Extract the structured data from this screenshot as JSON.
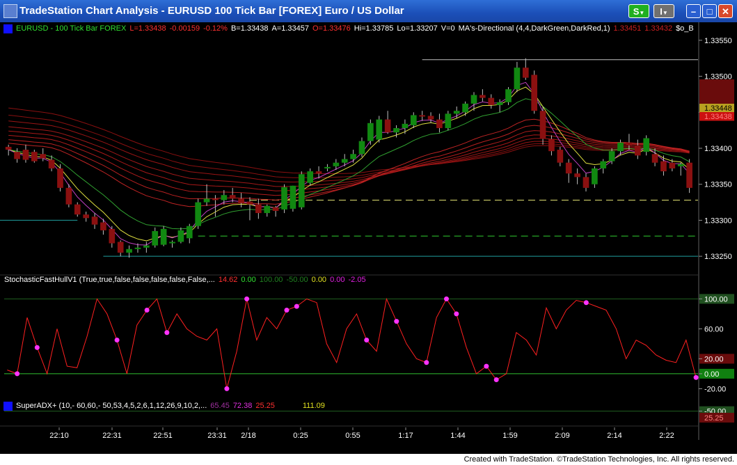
{
  "window": {
    "title": "TradeStation Chart Analysis - EURUSD 100 Tick Bar [FOREX] Euro / US Dollar",
    "s_button": "S",
    "i_button": "I",
    "minimize_glyph": "–",
    "maximize_glyph": "□",
    "close_glyph": "✕"
  },
  "colors": {
    "background": "#000000",
    "up_candle": "#118811",
    "down_candle": "#8b1010",
    "stoch_line": "#ff2020",
    "marker": "#ff33ff",
    "title_bar": "#1b4fb8"
  },
  "price_legend": {
    "symbol": "EURUSD - 100 Tick Bar  FOREX",
    "last": "L=1.33438",
    "change": "-0.00159",
    "pct": "-0.12%",
    "bid": "B=1.33438",
    "ask": "A=1.33457",
    "open": "O=1.33476",
    "high": "Hi=1.33785",
    "low": "Lo=1.33207",
    "volume": "V=0",
    "study": "MA's-Directional (4,4,DarkGreen,DarkRed,1)",
    "v1": "1.33451",
    "v2": "1.33432",
    "extra": "$o_B"
  },
  "stoch_legend": {
    "name": "StochasticFastHullV1 (True,true,false,false,false,false,False,...",
    "v1": "14.62",
    "v2": "0.00",
    "v3": "100.00",
    "v4": "-50.00",
    "v5": "0.00",
    "v6": "0.00",
    "v7": "-2.05"
  },
  "adx_legend": {
    "name": "SuperADX+ (10,- 60,60,- 50,53,4,5,2,6,1,12,26,9,10,2,...",
    "v1": "65.45",
    "v2": "72.38",
    "v3": "25.25",
    "v4": "111.09"
  },
  "price_axis": [
    "1.33550",
    "1.33500",
    "1.33450",
    "1.33400",
    "1.33350",
    "1.33300",
    "1.33250"
  ],
  "price_tags": [
    {
      "label": "1.33448",
      "color": "#b8a020",
      "text_color": "#000000"
    },
    {
      "label": "1.33438",
      "color": "#cc1010",
      "text_color": "#ff8080"
    }
  ],
  "stoch_axis": [
    "100.00",
    "60.00",
    "20.00",
    "0.00",
    "-20.00",
    "-50.00"
  ],
  "adx_axis": [
    "25.25"
  ],
  "time_axis": [
    "22:10",
    "22:31",
    "22:51",
    "23:31",
    "2/18",
    "0:25",
    "0:55",
    "1:17",
    "1:44",
    "1:59",
    "2:09",
    "2:14",
    "2:22"
  ],
  "candles": [
    {
      "o": 1.33402,
      "h": 1.33405,
      "l": 1.3339,
      "c": 1.33398
    },
    {
      "o": 1.33395,
      "h": 1.334,
      "l": 1.3338,
      "c": 1.33385
    },
    {
      "o": 1.33398,
      "h": 1.33405,
      "l": 1.3338,
      "c": 1.33384
    },
    {
      "o": 1.33395,
      "h": 1.33398,
      "l": 1.3338,
      "c": 1.33382
    },
    {
      "o": 1.33392,
      "h": 1.334,
      "l": 1.33382,
      "c": 1.33386
    },
    {
      "o": 1.33384,
      "h": 1.3339,
      "l": 1.33368,
      "c": 1.33372
    },
    {
      "o": 1.33372,
      "h": 1.33378,
      "l": 1.3334,
      "c": 1.33345
    },
    {
      "o": 1.33345,
      "h": 1.3335,
      "l": 1.33318,
      "c": 1.33322
    },
    {
      "o": 1.33322,
      "h": 1.33325,
      "l": 1.33305,
      "c": 1.33308
    },
    {
      "o": 1.33308,
      "h": 1.33312,
      "l": 1.33298,
      "c": 1.33303
    },
    {
      "o": 1.33305,
      "h": 1.3331,
      "l": 1.33288,
      "c": 1.33294
    },
    {
      "o": 1.33297,
      "h": 1.33302,
      "l": 1.3328,
      "c": 1.33286
    },
    {
      "o": 1.33288,
      "h": 1.33292,
      "l": 1.33262,
      "c": 1.33268
    },
    {
      "o": 1.3327,
      "h": 1.33272,
      "l": 1.3325,
      "c": 1.33255
    },
    {
      "o": 1.33255,
      "h": 1.33265,
      "l": 1.33248,
      "c": 1.3326
    },
    {
      "o": 1.3326,
      "h": 1.33268,
      "l": 1.33255,
      "c": 1.33262
    },
    {
      "o": 1.33262,
      "h": 1.3327,
      "l": 1.33255,
      "c": 1.33265
    },
    {
      "o": 1.33265,
      "h": 1.3329,
      "l": 1.33262,
      "c": 1.33285
    },
    {
      "o": 1.33266,
      "h": 1.33292,
      "l": 1.33264,
      "c": 1.33288
    },
    {
      "o": 1.33268,
      "h": 1.33272,
      "l": 1.33262,
      "c": 1.3327
    },
    {
      "o": 1.3327,
      "h": 1.3329,
      "l": 1.33268,
      "c": 1.33286
    },
    {
      "o": 1.33275,
      "h": 1.33295,
      "l": 1.33268,
      "c": 1.33292
    },
    {
      "o": 1.33292,
      "h": 1.3333,
      "l": 1.33288,
      "c": 1.33325
    },
    {
      "o": 1.33325,
      "h": 1.3335,
      "l": 1.3332,
      "c": 1.3333
    },
    {
      "o": 1.3333,
      "h": 1.33335,
      "l": 1.33305,
      "c": 1.33328
    },
    {
      "o": 1.33328,
      "h": 1.33342,
      "l": 1.33322,
      "c": 1.33335
    },
    {
      "o": 1.33335,
      "h": 1.33345,
      "l": 1.33325,
      "c": 1.3333
    },
    {
      "o": 1.3333,
      "h": 1.33338,
      "l": 1.33318,
      "c": 1.33324
    },
    {
      "o": 1.33326,
      "h": 1.33332,
      "l": 1.333,
      "c": 1.33322
    },
    {
      "o": 1.33322,
      "h": 1.3333,
      "l": 1.33302,
      "c": 1.3331
    },
    {
      "o": 1.3331,
      "h": 1.33322,
      "l": 1.33305,
      "c": 1.3332
    },
    {
      "o": 1.33318,
      "h": 1.3332,
      "l": 1.33305,
      "c": 1.33313
    },
    {
      "o": 1.33315,
      "h": 1.3335,
      "l": 1.3331,
      "c": 1.33346
    },
    {
      "o": 1.33316,
      "h": 1.33348,
      "l": 1.33312,
      "c": 1.33348
    },
    {
      "o": 1.33318,
      "h": 1.33368,
      "l": 1.33315,
      "c": 1.33364
    },
    {
      "o": 1.33352,
      "h": 1.33372,
      "l": 1.33348,
      "c": 1.33368
    },
    {
      "o": 1.33368,
      "h": 1.33375,
      "l": 1.33358,
      "c": 1.33365
    },
    {
      "o": 1.33372,
      "h": 1.33378,
      "l": 1.33368,
      "c": 1.33374
    },
    {
      "o": 1.33375,
      "h": 1.33385,
      "l": 1.3337,
      "c": 1.3338
    },
    {
      "o": 1.3338,
      "h": 1.33392,
      "l": 1.33375,
      "c": 1.33385
    },
    {
      "o": 1.33385,
      "h": 1.33398,
      "l": 1.3338,
      "c": 1.33392
    },
    {
      "o": 1.33392,
      "h": 1.33415,
      "l": 1.33388,
      "c": 1.3341
    },
    {
      "o": 1.3341,
      "h": 1.3344,
      "l": 1.33405,
      "c": 1.33435
    },
    {
      "o": 1.33412,
      "h": 1.33445,
      "l": 1.33408,
      "c": 1.3344
    },
    {
      "o": 1.3344,
      "h": 1.33452,
      "l": 1.3342,
      "c": 1.33422
    },
    {
      "o": 1.33422,
      "h": 1.33432,
      "l": 1.33415,
      "c": 1.33428
    },
    {
      "o": 1.33428,
      "h": 1.3344,
      "l": 1.3342,
      "c": 1.33434
    },
    {
      "o": 1.33432,
      "h": 1.3345,
      "l": 1.33428,
      "c": 1.33446
    },
    {
      "o": 1.33446,
      "h": 1.33452,
      "l": 1.33438,
      "c": 1.33444
    },
    {
      "o": 1.33445,
      "h": 1.3345,
      "l": 1.33435,
      "c": 1.3344
    },
    {
      "o": 1.3344,
      "h": 1.33448,
      "l": 1.33422,
      "c": 1.33428
    },
    {
      "o": 1.33428,
      "h": 1.33452,
      "l": 1.33425,
      "c": 1.33448
    },
    {
      "o": 1.33448,
      "h": 1.33458,
      "l": 1.33442,
      "c": 1.33452
    },
    {
      "o": 1.3345,
      "h": 1.33465,
      "l": 1.33445,
      "c": 1.33462
    },
    {
      "o": 1.33462,
      "h": 1.33478,
      "l": 1.33452,
      "c": 1.33474
    },
    {
      "o": 1.33474,
      "h": 1.33482,
      "l": 1.33465,
      "c": 1.3347
    },
    {
      "o": 1.3347,
      "h": 1.33475,
      "l": 1.33455,
      "c": 1.3346
    },
    {
      "o": 1.3346,
      "h": 1.33468,
      "l": 1.3345,
      "c": 1.33464
    },
    {
      "o": 1.33464,
      "h": 1.33485,
      "l": 1.3346,
      "c": 1.33482
    },
    {
      "o": 1.33482,
      "h": 1.3352,
      "l": 1.33478,
      "c": 1.33512
    },
    {
      "o": 1.33512,
      "h": 1.33525,
      "l": 1.33495,
      "c": 1.33498
    },
    {
      "o": 1.33502,
      "h": 1.33508,
      "l": 1.33448,
      "c": 1.33452
    },
    {
      "o": 1.33452,
      "h": 1.33458,
      "l": 1.33405,
      "c": 1.33413
    },
    {
      "o": 1.33413,
      "h": 1.33418,
      "l": 1.3339,
      "c": 1.33396
    },
    {
      "o": 1.33398,
      "h": 1.33402,
      "l": 1.33375,
      "c": 1.3338
    },
    {
      "o": 1.3338,
      "h": 1.33385,
      "l": 1.33352,
      "c": 1.33365
    },
    {
      "o": 1.33365,
      "h": 1.33372,
      "l": 1.3335,
      "c": 1.3336
    },
    {
      "o": 1.3336,
      "h": 1.33365,
      "l": 1.3334,
      "c": 1.33345
    },
    {
      "o": 1.3335,
      "h": 1.33375,
      "l": 1.33345,
      "c": 1.33372
    },
    {
      "o": 1.33372,
      "h": 1.33385,
      "l": 1.33365,
      "c": 1.33382
    },
    {
      "o": 1.33382,
      "h": 1.334,
      "l": 1.33378,
      "c": 1.33396
    },
    {
      "o": 1.33396,
      "h": 1.33412,
      "l": 1.3339,
      "c": 1.33408
    },
    {
      "o": 1.33408,
      "h": 1.3342,
      "l": 1.33398,
      "c": 1.33404
    },
    {
      "o": 1.33404,
      "h": 1.33412,
      "l": 1.33385,
      "c": 1.3339
    },
    {
      "o": 1.33395,
      "h": 1.33418,
      "l": 1.3339,
      "c": 1.33414
    },
    {
      "o": 1.33392,
      "h": 1.334,
      "l": 1.33375,
      "c": 1.3338
    },
    {
      "o": 1.33382,
      "h": 1.3339,
      "l": 1.33362,
      "c": 1.33368
    },
    {
      "o": 1.3338,
      "h": 1.33385,
      "l": 1.33368,
      "c": 1.33372
    },
    {
      "o": 1.33375,
      "h": 1.3338,
      "l": 1.33362,
      "c": 1.33378
    },
    {
      "o": 1.3338,
      "h": 1.33385,
      "l": 1.33338,
      "c": 1.33345
    }
  ],
  "stoch_values": [
    5,
    0,
    75,
    35,
    0,
    60,
    10,
    8,
    50,
    100,
    80,
    45,
    0,
    65,
    85,
    100,
    55,
    80,
    60,
    50,
    45,
    60,
    -20,
    30,
    100,
    45,
    75,
    60,
    85,
    90,
    100,
    95,
    40,
    15,
    60,
    80,
    45,
    30,
    100,
    70,
    40,
    20,
    15,
    75,
    100,
    80,
    35,
    0,
    10,
    -8,
    0,
    55,
    45,
    25,
    88,
    60,
    85,
    98,
    95,
    90,
    85,
    60,
    20,
    45,
    38,
    25,
    18,
    15,
    45,
    -5
  ],
  "stoch_markers": [
    1,
    3,
    11,
    14,
    16,
    22,
    24,
    28,
    29,
    36,
    39,
    42,
    44,
    45,
    48,
    49,
    58,
    69
  ],
  "horizontal_levels": [
    {
      "price": 1.333,
      "style": "solid",
      "color": "#20a0a0"
    },
    {
      "price": 1.3325,
      "style": "solid",
      "color": "#20a0a0"
    },
    {
      "price": 1.33328,
      "style": "dashed",
      "color": "#e0e070"
    },
    {
      "price": 1.33278,
      "style": "dashed",
      "color": "#30d030"
    },
    {
      "price": 1.33523,
      "style": "solid",
      "color": "#c0c0c0"
    }
  ],
  "footer": {
    "text": "Created with TradeStation. ©TradeStation Technologies, Inc. All rights reserved."
  }
}
